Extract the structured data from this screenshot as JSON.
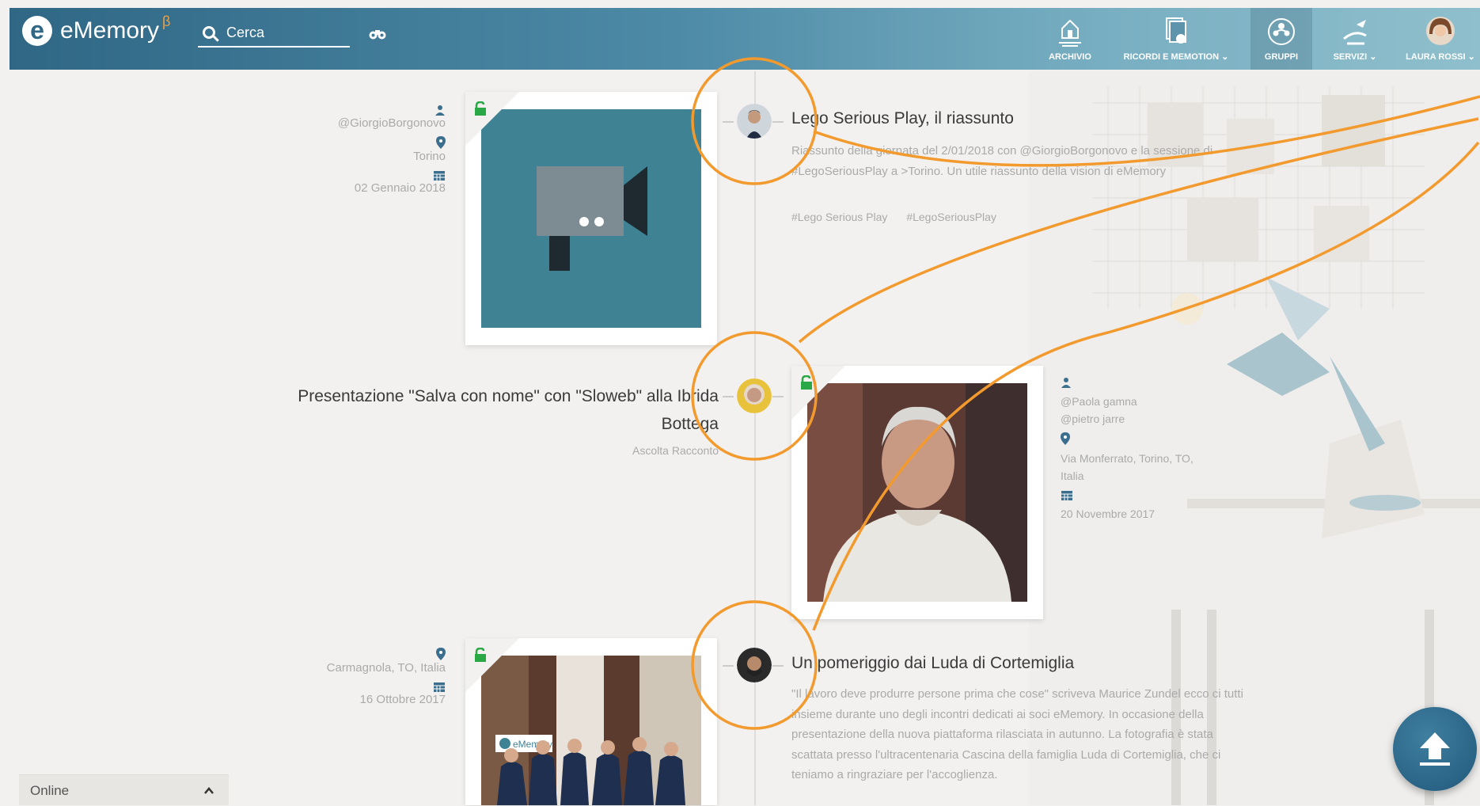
{
  "brand": {
    "name": "eMemory",
    "beta": "β"
  },
  "search": {
    "placeholder": "Cerca"
  },
  "nav": {
    "archivio": "ARCHIVIO",
    "ricordi": "RICORDI E MEMOTION",
    "gruppi": "GRUPPI",
    "servizi": "SERVIZI",
    "user": "LAURA ROSSI"
  },
  "timeline": {
    "post1": {
      "author": "@GiorgioBorgonovo",
      "location": "Torino",
      "date": "02 Gennaio 2018",
      "title": "Lego Serious Play, il riassunto",
      "description": "Riassunto della giornata del 2/01/2018 con @GiorgioBorgonovo e la sessione di #LegoSeriousPlay a >Torino. Un utile riassunto della vision di eMemory",
      "tags": [
        "#Lego Serious Play",
        "#LegoSeriousPlay"
      ]
    },
    "post2": {
      "title": "Presentazione \"Salva con nome\" con \"Sloweb\" alla Ibrida Bottega",
      "link": "Ascolta Racconto",
      "people": [
        "@Paola gamna",
        "@pietro jarre"
      ],
      "location": "Via Monferrato, Torino, TO, Italia",
      "date": "20 Novembre 2017"
    },
    "post3": {
      "location": "Carmagnola, TO, Italia",
      "date": "16 Ottobre 2017",
      "title": "Un pomeriggio dai Luda di Cortemiglia",
      "description": "\"Il lavoro deve produrre persone prima che cose\" scriveva Maurice Zundel ecco ci tutti insieme durante uno degli incontri dedicati ai soci eMemory. In occasione della presentazione della nuova piattaforma rilasciata in autunno. La fotografia è stata scattata presso l'ultracentenaria Cascina della famiglia Luda di Cortemiglia, che ci teniamo a ringraziare per l'accoglienza.",
      "banner": "eMemory"
    }
  },
  "chat": {
    "status": "Online"
  },
  "colors": {
    "accent": "#f39a2e",
    "header": "#2f6785",
    "lock": "#2aa845"
  }
}
